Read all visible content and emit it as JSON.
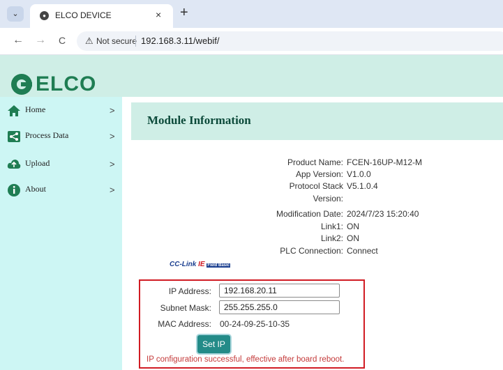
{
  "browser": {
    "tab_title": "ELCO DEVICE",
    "tab_close": "×",
    "new_tab": "+",
    "tab_menu": "⌄",
    "back": "←",
    "forward": "→",
    "reload": "C",
    "security_label": "Not secure",
    "url": "192.168.3.11/webif/"
  },
  "header": {
    "logo_text": "ELCO",
    "brand_color": "#1f7d53"
  },
  "sidebar": {
    "items": [
      {
        "label": "Home",
        "icon": "home-icon",
        "chevron": ">"
      },
      {
        "label": "Process Data",
        "icon": "share-icon",
        "chevron": ">"
      },
      {
        "label": "Upload",
        "icon": "cloud-upload-icon",
        "chevron": ">"
      },
      {
        "label": "About",
        "icon": "info-icon",
        "chevron": ">"
      }
    ]
  },
  "panel": {
    "title": "Module Information"
  },
  "info": {
    "product_name_label": "Product Name:",
    "product_name": "FCEN-16UP-M12-M",
    "app_version_label": "App Version:",
    "app_version": "V1.0.0",
    "protocol_stack_label_1": "Protocol Stack",
    "protocol_stack_label_2": "Version:",
    "protocol_stack": "V5.1.0.4",
    "mod_date_label": "Modification Date:",
    "mod_date": "2024/7/23 15:20:40",
    "link1_label": "Link1:",
    "link1": "ON",
    "link2_label": "Link2:",
    "link2": "ON",
    "plc_label": "PLC Connection:",
    "plc": "Connect",
    "cclink_logo": "CC-Link IE Field Basic"
  },
  "ip_config": {
    "ip_label": "IP Address:",
    "ip_value": "192.168.20.11",
    "subnet_label": "Subnet Mask:",
    "subnet_value": "255.255.255.0",
    "mac_label": "MAC Address:",
    "mac_value": "00-24-09-25-10-35",
    "set_ip_button": "Set IP",
    "status_message": "IP configuration successful, effective after board reboot.",
    "highlight_color": "#d11b23"
  }
}
